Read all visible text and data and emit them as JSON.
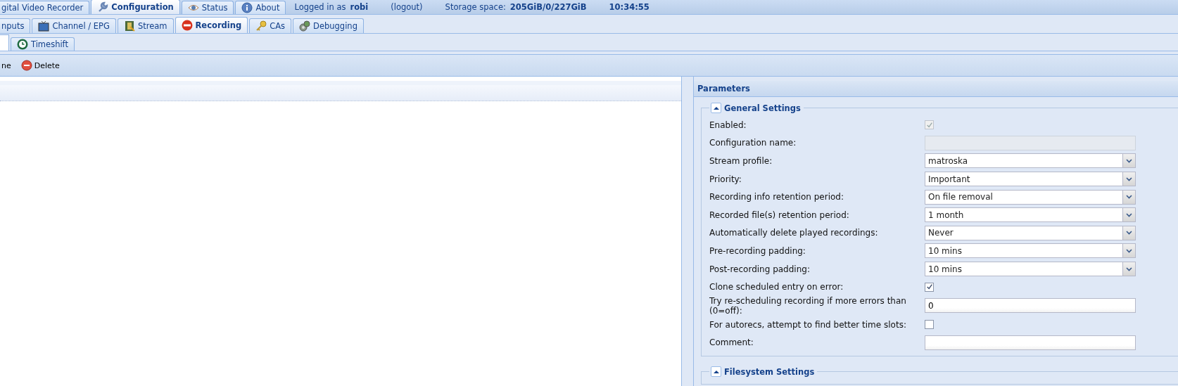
{
  "main_tabs": [
    {
      "label": "gital Video Recorder",
      "selected": false
    },
    {
      "label": "Configuration",
      "selected": true
    },
    {
      "label": "Status",
      "selected": false
    },
    {
      "label": "About",
      "selected": false
    }
  ],
  "session": {
    "logged_in_label": "Logged in as",
    "user": "robi",
    "logout": "(logout)",
    "storage_label": "Storage space:",
    "storage": "205GiB/0/227GiB",
    "time": "10:34:55"
  },
  "config_tabs": [
    {
      "label": "nputs",
      "selected": false
    },
    {
      "label": "Channel / EPG",
      "selected": false
    },
    {
      "label": "Stream",
      "selected": false
    },
    {
      "label": "Recording",
      "selected": true
    },
    {
      "label": "CAs",
      "selected": false
    },
    {
      "label": "Debugging",
      "selected": false
    }
  ],
  "recording_tabs": [
    {
      "label": "Timeshift",
      "selected": false
    }
  ],
  "toolbar": [
    {
      "label": "ne"
    },
    {
      "label": "Delete"
    }
  ],
  "parameters": {
    "title": "Parameters",
    "sections": [
      {
        "title": "General Settings",
        "expanded": true,
        "fields": [
          {
            "label": "Enabled:",
            "kind": "checkbox",
            "checked": true,
            "disabled": true
          },
          {
            "label": "Configuration name:",
            "kind": "text",
            "disabled": true
          },
          {
            "label": "Stream profile:",
            "kind": "select",
            "value": "matroska"
          },
          {
            "label": "Priority:",
            "kind": "select",
            "value": "Important"
          },
          {
            "label": "Recording info retention period:",
            "kind": "select",
            "value": "On file removal"
          },
          {
            "label": "Recorded file(s) retention period:",
            "kind": "select",
            "value": "1 month"
          },
          {
            "label": "Automatically delete played recordings:",
            "kind": "select",
            "value": "Never"
          },
          {
            "label": "Pre-recording padding:",
            "kind": "select",
            "value": "10 mins"
          },
          {
            "label": "Post-recording padding:",
            "kind": "select",
            "value": "10 mins"
          },
          {
            "label": "Clone scheduled entry on error:",
            "kind": "checkbox",
            "checked": true,
            "disabled": false
          },
          {
            "label": "Try re-scheduling recording if more errors than (0=off):",
            "kind": "text",
            "value": "0",
            "disabled": false
          },
          {
            "label": "For autorecs, attempt to find better time slots:",
            "kind": "checkbox",
            "checked": false,
            "disabled": false
          },
          {
            "label": "Comment:",
            "kind": "text",
            "disabled": false
          }
        ]
      },
      {
        "title": "Filesystem Settings",
        "expanded": true
      }
    ]
  }
}
